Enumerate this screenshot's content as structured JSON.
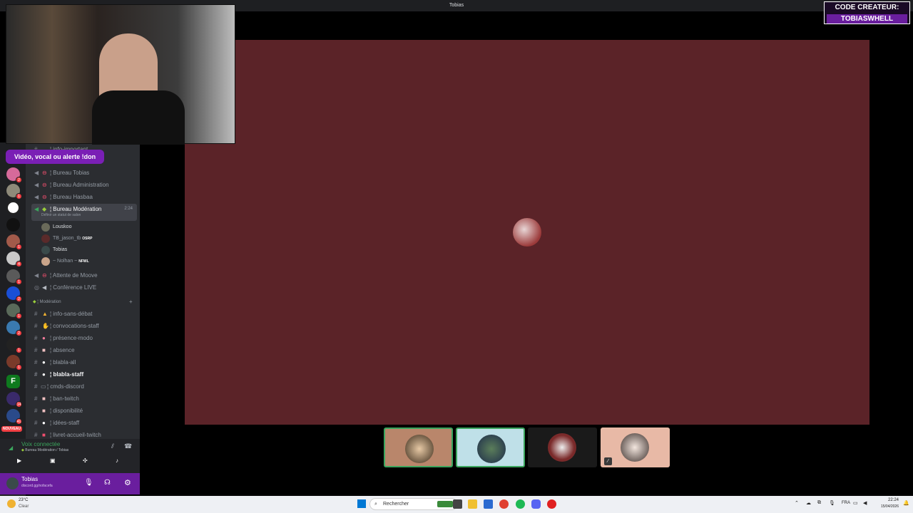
{
  "window": {
    "title": "Tobias"
  },
  "creator_banner": {
    "line1": "CODE CREATEUR:",
    "line2": "TOBIASWHELL"
  },
  "promo_banner": "Vidéo, vocal ou alerte !don",
  "channels": [
    {
      "name": "¦ info-important",
      "type": "text"
    },
    {
      "name": "¦ Bureau Tobias",
      "type": "voice"
    },
    {
      "name": "¦ Bureau Administration",
      "type": "voice"
    },
    {
      "name": "¦ Bureau Hasbaa",
      "type": "voice"
    },
    {
      "name": "¦ Bureau Modération",
      "type": "voice",
      "active": true,
      "timer": "2:24",
      "status": "Définir un statut de salon"
    },
    {
      "name": "¦ Attente de Moove",
      "type": "voice"
    },
    {
      "name": "¦ Conférence LIVE",
      "type": "stage"
    }
  ],
  "voice_members": [
    {
      "name": "Louskoo"
    },
    {
      "name": "TB_jason_tb",
      "tag": "OSRP"
    },
    {
      "name": "Tobias"
    },
    {
      "name": "~ Nolhan ~",
      "tag": "NFWL"
    }
  ],
  "category": {
    "name": "¦ Modération"
  },
  "category_channels": [
    {
      "name": "¦ info-sans-débat"
    },
    {
      "name": "¦ convocations-staff"
    },
    {
      "name": "¦ présence-modo"
    },
    {
      "name": "¦ absence"
    },
    {
      "name": "¦ blabla-all"
    },
    {
      "name": "¦ blabla-staff",
      "bold": true
    },
    {
      "name": "¦ cmds-discord"
    },
    {
      "name": "¦ ban-twitch"
    },
    {
      "name": "¦ disponibilité"
    },
    {
      "name": "¦ idées-staff"
    },
    {
      "name": "¦ livret-accueil-twitch"
    }
  ],
  "guild_badges": [
    "2",
    "1",
    "",
    "",
    "1",
    "4",
    "1",
    "2",
    "1",
    "2",
    "1",
    "1",
    "",
    "14",
    "41"
  ],
  "guild_new_label": "NOUVEAU",
  "voice_panel": {
    "status": "Voix connectée",
    "location": "Bureau Modération / Tobias"
  },
  "user_panel": {
    "name": "Tobias",
    "subtext": "discord.gg/nofacefa"
  },
  "taskbar": {
    "weather_temp": "23°C",
    "weather_desc": "Clear",
    "search_placeholder": "Rechercher",
    "lang": "FRA",
    "time": "22:24",
    "date": "15/04/2026"
  },
  "colors": {
    "main_video_bg": "#5b2328",
    "accent": "#6a1e9e",
    "active_tile_border": "#3ba55d"
  }
}
